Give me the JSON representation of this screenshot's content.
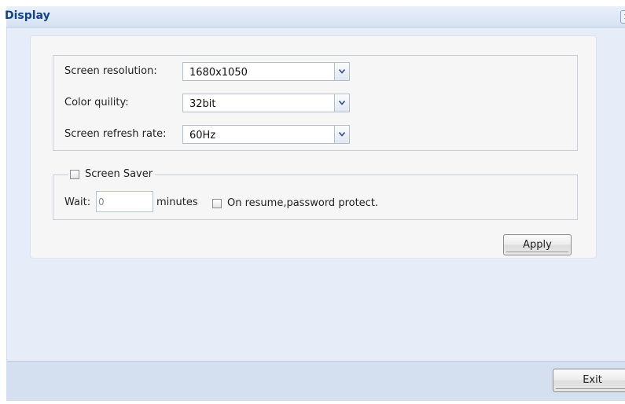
{
  "window": {
    "title": "Display",
    "close_label": "x"
  },
  "display_settings": {
    "resolution": {
      "label": "Screen resolution:",
      "value": "1680x1050"
    },
    "color_quality": {
      "label": "Color quility:",
      "value": "32bit"
    },
    "refresh_rate": {
      "label": "Screen refresh rate:",
      "value": "60Hz"
    }
  },
  "screen_saver": {
    "label": "Screen Saver",
    "enabled": false,
    "wait_label": "Wait:",
    "wait_value": "0",
    "minutes_label": "minutes",
    "resume_label": "On resume,password protect.",
    "resume_checked": false
  },
  "buttons": {
    "apply_label": "Apply",
    "exit_label": "Exit"
  },
  "icons": {
    "dropdown": "chevron-down-icon",
    "close": "close-icon"
  },
  "colors": {
    "title_text": "#15428b",
    "panel_background": "#e6edf8",
    "card_background": "#f6f6f6"
  }
}
